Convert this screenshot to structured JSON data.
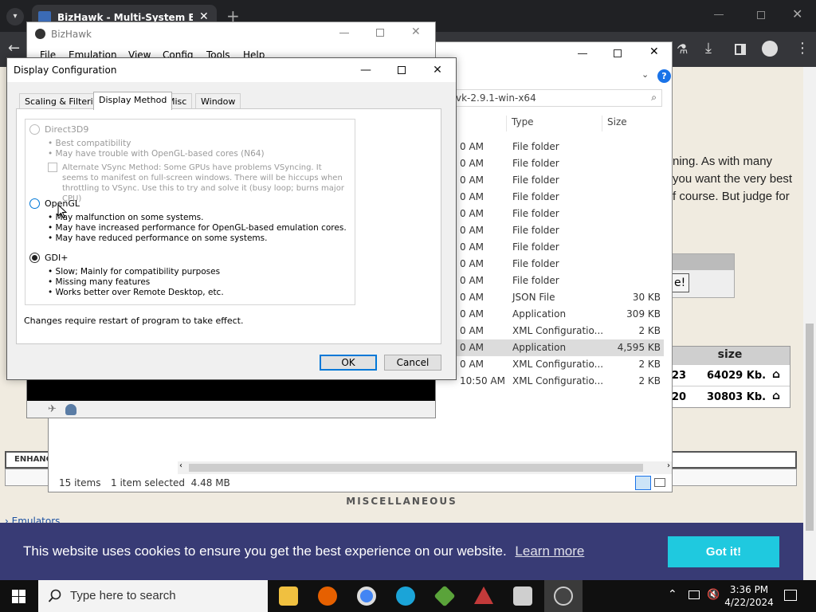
{
  "browser": {
    "tab_title": "BizHawk - Multi-System Emulat",
    "tab_close": "✕",
    "new_tab": "+"
  },
  "webpage": {
    "text_lines": [
      "ning. As with many",
      "you want the very best",
      "f course. But judge for"
    ],
    "button_fragment": "e!",
    "size_header": "size",
    "size_rows": [
      {
        "left": "23",
        "value": "64029 Kb."
      },
      {
        "left": "20",
        "value": "30803 Kb."
      }
    ],
    "enhance_label": "ENHANC",
    "misc_heading": "MISCELLANEOUS",
    "emulators_link": "› Emulators"
  },
  "cookie": {
    "message": "This website uses cookies to ensure you get the best experience on our website.",
    "learn_more": "Learn more",
    "button": "Got it!"
  },
  "taskbar": {
    "search_placeholder": "Type here to search",
    "time": "3:36 PM",
    "date": "4/22/2024"
  },
  "explorer": {
    "address": "vk-2.9.1-win-x64",
    "columns": {
      "type": "Type",
      "size": "Size"
    },
    "rows": [
      {
        "date": "0 AM",
        "type": "File folder",
        "size": ""
      },
      {
        "date": "0 AM",
        "type": "File folder",
        "size": ""
      },
      {
        "date": "0 AM",
        "type": "File folder",
        "size": ""
      },
      {
        "date": "0 AM",
        "type": "File folder",
        "size": ""
      },
      {
        "date": "0 AM",
        "type": "File folder",
        "size": ""
      },
      {
        "date": "0 AM",
        "type": "File folder",
        "size": ""
      },
      {
        "date": "0 AM",
        "type": "File folder",
        "size": ""
      },
      {
        "date": "0 AM",
        "type": "File folder",
        "size": ""
      },
      {
        "date": "0 AM",
        "type": "File folder",
        "size": ""
      },
      {
        "date": "0 AM",
        "type": "JSON File",
        "size": "30 KB"
      },
      {
        "date": "0 AM",
        "type": "Application",
        "size": "309 KB"
      },
      {
        "date": "0 AM",
        "type": "XML Configuratio...",
        "size": "2 KB"
      },
      {
        "date": "0 AM",
        "type": "Application",
        "size": "4,595 KB",
        "selected": true
      },
      {
        "date": "0 AM",
        "type": "XML Configuratio...",
        "size": "2 KB"
      },
      {
        "date": "10:50 AM",
        "type": "XML Configuratio...",
        "size": "2 KB"
      }
    ],
    "status_items": "15 items",
    "status_selected": "1 item selected  4.48 MB"
  },
  "bizhawk": {
    "title": "BizHawk",
    "menu": [
      "File",
      "Emulation",
      "View",
      "Config",
      "Tools",
      "Help"
    ]
  },
  "dialog": {
    "title": "Display Configuration",
    "tabs": [
      "Scaling & Filtering",
      "Display Method",
      "Misc",
      "Window"
    ],
    "active_tab": "Display Method",
    "options": {
      "d3d": {
        "label": "Direct3D9",
        "bullets": [
          "• Best compatibility",
          "• May have trouble with OpenGL-based cores (N64)"
        ],
        "vsync_note": "Alternate VSync Method: Some GPUs have problems VSyncing. It seems to manifest on full-screen windows. There will be hiccups when throttling to VSync. Use this to try and solve it (busy loop; burns major CPU)"
      },
      "opengl": {
        "label": "OpenGL",
        "bullets": [
          "• May malfunction on some systems.",
          "• May have increased performance for OpenGL-based emulation cores.",
          "• May have reduced performance on some systems."
        ]
      },
      "gdi": {
        "label": "GDI+",
        "bullets": [
          "• Slow; Mainly for compatibility purposes",
          "• Missing many features",
          "• Works better over Remote Desktop, etc."
        ]
      }
    },
    "selected_option": "GDI+",
    "restart_note": "Changes require restart of program to take effect.",
    "ok": "OK",
    "cancel": "Cancel"
  },
  "colors": {
    "cookie_bg": "#383b75",
    "cookie_button": "#1fc9df",
    "accent": "#0078d7"
  }
}
